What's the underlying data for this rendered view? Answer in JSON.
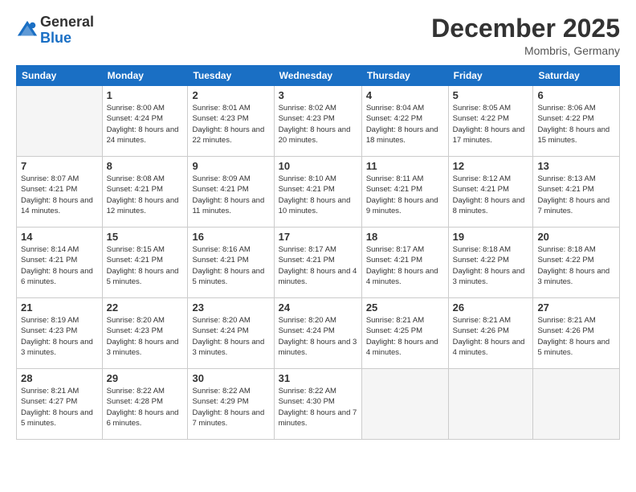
{
  "header": {
    "logo_line1": "General",
    "logo_line2": "Blue",
    "month_year": "December 2025",
    "location": "Mombris, Germany"
  },
  "weekdays": [
    "Sunday",
    "Monday",
    "Tuesday",
    "Wednesday",
    "Thursday",
    "Friday",
    "Saturday"
  ],
  "weeks": [
    [
      {
        "day": "",
        "sunrise": "",
        "sunset": "",
        "daylight": ""
      },
      {
        "day": "1",
        "sunrise": "Sunrise: 8:00 AM",
        "sunset": "Sunset: 4:24 PM",
        "daylight": "Daylight: 8 hours and 24 minutes."
      },
      {
        "day": "2",
        "sunrise": "Sunrise: 8:01 AM",
        "sunset": "Sunset: 4:23 PM",
        "daylight": "Daylight: 8 hours and 22 minutes."
      },
      {
        "day": "3",
        "sunrise": "Sunrise: 8:02 AM",
        "sunset": "Sunset: 4:23 PM",
        "daylight": "Daylight: 8 hours and 20 minutes."
      },
      {
        "day": "4",
        "sunrise": "Sunrise: 8:04 AM",
        "sunset": "Sunset: 4:22 PM",
        "daylight": "Daylight: 8 hours and 18 minutes."
      },
      {
        "day": "5",
        "sunrise": "Sunrise: 8:05 AM",
        "sunset": "Sunset: 4:22 PM",
        "daylight": "Daylight: 8 hours and 17 minutes."
      },
      {
        "day": "6",
        "sunrise": "Sunrise: 8:06 AM",
        "sunset": "Sunset: 4:22 PM",
        "daylight": "Daylight: 8 hours and 15 minutes."
      }
    ],
    [
      {
        "day": "7",
        "sunrise": "Sunrise: 8:07 AM",
        "sunset": "Sunset: 4:21 PM",
        "daylight": "Daylight: 8 hours and 14 minutes."
      },
      {
        "day": "8",
        "sunrise": "Sunrise: 8:08 AM",
        "sunset": "Sunset: 4:21 PM",
        "daylight": "Daylight: 8 hours and 12 minutes."
      },
      {
        "day": "9",
        "sunrise": "Sunrise: 8:09 AM",
        "sunset": "Sunset: 4:21 PM",
        "daylight": "Daylight: 8 hours and 11 minutes."
      },
      {
        "day": "10",
        "sunrise": "Sunrise: 8:10 AM",
        "sunset": "Sunset: 4:21 PM",
        "daylight": "Daylight: 8 hours and 10 minutes."
      },
      {
        "day": "11",
        "sunrise": "Sunrise: 8:11 AM",
        "sunset": "Sunset: 4:21 PM",
        "daylight": "Daylight: 8 hours and 9 minutes."
      },
      {
        "day": "12",
        "sunrise": "Sunrise: 8:12 AM",
        "sunset": "Sunset: 4:21 PM",
        "daylight": "Daylight: 8 hours and 8 minutes."
      },
      {
        "day": "13",
        "sunrise": "Sunrise: 8:13 AM",
        "sunset": "Sunset: 4:21 PM",
        "daylight": "Daylight: 8 hours and 7 minutes."
      }
    ],
    [
      {
        "day": "14",
        "sunrise": "Sunrise: 8:14 AM",
        "sunset": "Sunset: 4:21 PM",
        "daylight": "Daylight: 8 hours and 6 minutes."
      },
      {
        "day": "15",
        "sunrise": "Sunrise: 8:15 AM",
        "sunset": "Sunset: 4:21 PM",
        "daylight": "Daylight: 8 hours and 5 minutes."
      },
      {
        "day": "16",
        "sunrise": "Sunrise: 8:16 AM",
        "sunset": "Sunset: 4:21 PM",
        "daylight": "Daylight: 8 hours and 5 minutes."
      },
      {
        "day": "17",
        "sunrise": "Sunrise: 8:17 AM",
        "sunset": "Sunset: 4:21 PM",
        "daylight": "Daylight: 8 hours and 4 minutes."
      },
      {
        "day": "18",
        "sunrise": "Sunrise: 8:17 AM",
        "sunset": "Sunset: 4:21 PM",
        "daylight": "Daylight: 8 hours and 4 minutes."
      },
      {
        "day": "19",
        "sunrise": "Sunrise: 8:18 AM",
        "sunset": "Sunset: 4:22 PM",
        "daylight": "Daylight: 8 hours and 3 minutes."
      },
      {
        "day": "20",
        "sunrise": "Sunrise: 8:18 AM",
        "sunset": "Sunset: 4:22 PM",
        "daylight": "Daylight: 8 hours and 3 minutes."
      }
    ],
    [
      {
        "day": "21",
        "sunrise": "Sunrise: 8:19 AM",
        "sunset": "Sunset: 4:23 PM",
        "daylight": "Daylight: 8 hours and 3 minutes."
      },
      {
        "day": "22",
        "sunrise": "Sunrise: 8:20 AM",
        "sunset": "Sunset: 4:23 PM",
        "daylight": "Daylight: 8 hours and 3 minutes."
      },
      {
        "day": "23",
        "sunrise": "Sunrise: 8:20 AM",
        "sunset": "Sunset: 4:24 PM",
        "daylight": "Daylight: 8 hours and 3 minutes."
      },
      {
        "day": "24",
        "sunrise": "Sunrise: 8:20 AM",
        "sunset": "Sunset: 4:24 PM",
        "daylight": "Daylight: 8 hours and 3 minutes."
      },
      {
        "day": "25",
        "sunrise": "Sunrise: 8:21 AM",
        "sunset": "Sunset: 4:25 PM",
        "daylight": "Daylight: 8 hours and 4 minutes."
      },
      {
        "day": "26",
        "sunrise": "Sunrise: 8:21 AM",
        "sunset": "Sunset: 4:26 PM",
        "daylight": "Daylight: 8 hours and 4 minutes."
      },
      {
        "day": "27",
        "sunrise": "Sunrise: 8:21 AM",
        "sunset": "Sunset: 4:26 PM",
        "daylight": "Daylight: 8 hours and 5 minutes."
      }
    ],
    [
      {
        "day": "28",
        "sunrise": "Sunrise: 8:21 AM",
        "sunset": "Sunset: 4:27 PM",
        "daylight": "Daylight: 8 hours and 5 minutes."
      },
      {
        "day": "29",
        "sunrise": "Sunrise: 8:22 AM",
        "sunset": "Sunset: 4:28 PM",
        "daylight": "Daylight: 8 hours and 6 minutes."
      },
      {
        "day": "30",
        "sunrise": "Sunrise: 8:22 AM",
        "sunset": "Sunset: 4:29 PM",
        "daylight": "Daylight: 8 hours and 7 minutes."
      },
      {
        "day": "31",
        "sunrise": "Sunrise: 8:22 AM",
        "sunset": "Sunset: 4:30 PM",
        "daylight": "Daylight: 8 hours and 7 minutes."
      },
      {
        "day": "",
        "sunrise": "",
        "sunset": "",
        "daylight": ""
      },
      {
        "day": "",
        "sunrise": "",
        "sunset": "",
        "daylight": ""
      },
      {
        "day": "",
        "sunrise": "",
        "sunset": "",
        "daylight": ""
      }
    ]
  ]
}
